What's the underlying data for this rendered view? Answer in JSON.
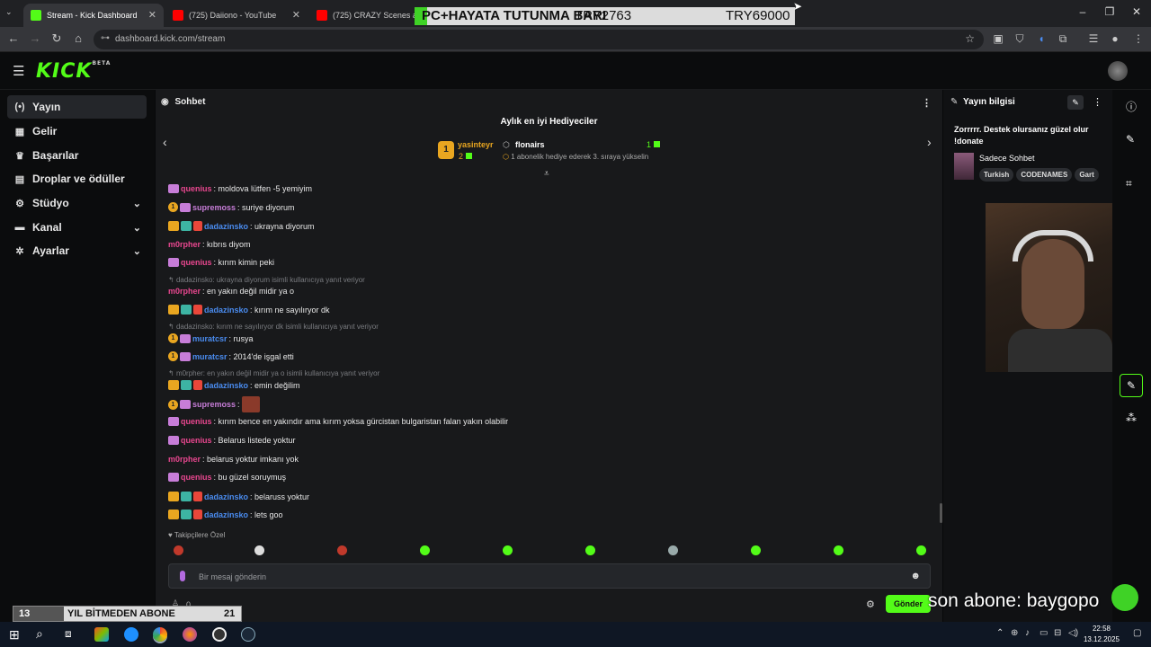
{
  "browser": {
    "tabs": [
      {
        "title": "Stream - Kick Dashboard"
      },
      {
        "title": "(725) Daiiono - YouTube"
      },
      {
        "title": "(725) CRAZY Scenes and All"
      }
    ],
    "url": "dashboard.kick.com/stream"
  },
  "overlay_top": {
    "left_text": "PC+HAYATA TUTUNMA BARI",
    "mid_text": "TRY2763",
    "right_text": "TRY69000"
  },
  "sidebar": {
    "items": [
      {
        "label": "Yayın",
        "icon": "broadcast-icon"
      },
      {
        "label": "Gelir",
        "icon": "money-icon"
      },
      {
        "label": "Başarılar",
        "icon": "trophy-icon"
      },
      {
        "label": "Droplar ve ödüller",
        "icon": "gift-icon"
      },
      {
        "label": "Stüdyo",
        "icon": "studio-icon"
      },
      {
        "label": "Kanal",
        "icon": "channel-icon"
      },
      {
        "label": "Ayarlar",
        "icon": "gear-icon"
      }
    ]
  },
  "chat": {
    "title": "Sohbet",
    "gifters_title": "Aylık en iyi Hediyeciler",
    "gifter1": {
      "rank": "1",
      "name": "yasinteyr",
      "count": "2"
    },
    "gifter2": {
      "name": "flonairs",
      "count": "1",
      "note": "1 abonelik hediye ederek 3. sıraya yükselin"
    },
    "messages": [
      {
        "user": "quenius",
        "text": ": moldova lütfen -5 yemiyim"
      },
      {
        "user": "supremoss",
        "text": ": suriye diyorum"
      },
      {
        "user": "dadazinsko",
        "text": ": ukrayna diyorum"
      },
      {
        "user": "m0rpher",
        "text": ": kıbrıs diyom"
      },
      {
        "user": "quenius",
        "text": ": kırım kimin peki"
      },
      {
        "user": "m0rpher",
        "text": ": en yakın değil midir ya o"
      },
      {
        "user": "dadazinsko",
        "text": ": kırım ne sayılıryor dk"
      },
      {
        "user": "muratcsr",
        "text": ": rusya"
      },
      {
        "user": "muratcsr",
        "text": ": 2014'de işgal etti"
      },
      {
        "user": "dadazinsko",
        "text": ": emin değilim"
      },
      {
        "user": "supremoss",
        "text": ":"
      },
      {
        "user": "quenius",
        "text": ": kırım bence en yakındır ama kırım yoksa gürcistan bulgaristan falan yakın olabilir"
      },
      {
        "user": "quenius",
        "text": ": Belarus listede yoktur"
      },
      {
        "user": "m0rpher",
        "text": ": belarus yoktur imkanı yok"
      },
      {
        "user": "quenius",
        "text": ": bu güzel soruymuş"
      },
      {
        "user": "dadazinsko",
        "text": ": belaruss yoktur"
      },
      {
        "user": "dadazinsko",
        "text": ": lets goo"
      }
    ],
    "replies": [
      "dadazinsko: ukrayna diyorum isimli kullanıcıya yanıt veriyor",
      "dadazinsko: kırım ne sayılıryor dk isimli kullanıcıya yanıt veriyor",
      "m0rpher: en yakın değil midir ya o isimli kullanıcıya yanıt veriyor"
    ],
    "followers_only": "Takipçilere Özel",
    "input_placeholder": "Bir mesaj gönderin",
    "count": "0",
    "send_label": "Gönder"
  },
  "stream_info": {
    "title": "Yayın bilgisi",
    "stream_title": "Zorrrrr. Destek olursanız güzel olur !donate",
    "mode": "Sadece Sohbet",
    "tags": [
      "Turkish",
      "CODENAMES",
      "Gart"
    ]
  },
  "overlay_bottom": {
    "left_num": "13",
    "left_text": "YIL BİTMEDEN ABONE",
    "right_num": "21",
    "right_text": "son abone: baygopo"
  },
  "taskbar": {
    "time": "22:58",
    "date": "13.12.2025"
  },
  "colors": {
    "kick_green": "#53fc18",
    "pink": "#e8478f",
    "blue": "#4a8cf0"
  }
}
